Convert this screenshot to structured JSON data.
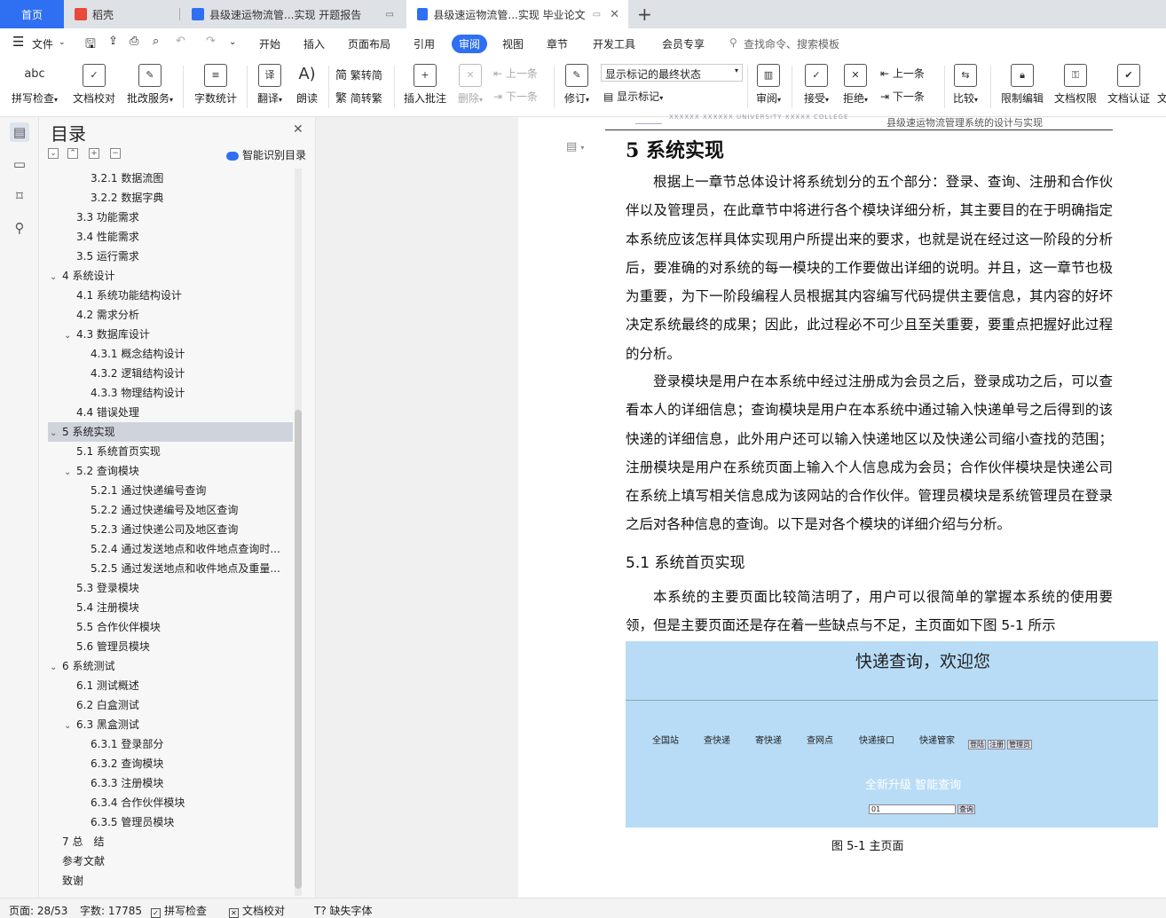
{
  "tabs": {
    "home": "首页",
    "daoke": "稻壳",
    "doc1": "县级速运物流管...实现 开题报告",
    "doc2": "县级速运物流管...实现 毕业论文",
    "add": "+"
  },
  "menu": {
    "file": "文件",
    "items": [
      "开始",
      "插入",
      "页面布局",
      "引用",
      "审阅",
      "视图",
      "章节",
      "开发工具",
      "会员专享"
    ],
    "search": "查找命令、搜索模板"
  },
  "ribbon": {
    "spellcheck": "拼写检查",
    "spellcheck_icon": "abc",
    "doc_proof": "文档校对",
    "correction_service": "批改服务",
    "word_count": "字数统计",
    "translate": "翻译",
    "read_aloud": "朗读",
    "trad_to_simp": "繁转简",
    "simp_to_trad": "简转繁",
    "insert_comment": "插入批注",
    "delete": "删除",
    "prev_comment": "上一条",
    "next_comment": "下一条",
    "track_changes": "修订",
    "markup_state": "显示标记的最终状态",
    "show_markup": "显示标记",
    "review_pane": "审阅",
    "accept": "接受",
    "reject": "拒绝",
    "prev_change": "上一条",
    "next_change": "下一条",
    "compare": "比较",
    "restrict_edit": "限制编辑",
    "doc_permission": "文档权限",
    "doc_certify": "文档认证",
    "more": "文"
  },
  "toc": {
    "title": "目录",
    "smart_label": "智能识别目录",
    "items": [
      {
        "text": "3.2.1 数据流图",
        "level": 3
      },
      {
        "text": "3.2.2 数据字典",
        "level": 3
      },
      {
        "text": "3.3 功能需求",
        "level": 2
      },
      {
        "text": "3.4 性能需求",
        "level": 2
      },
      {
        "text": "3.5 运行需求",
        "level": 2
      },
      {
        "text": "4 系统设计",
        "level": 1,
        "caret": true
      },
      {
        "text": "4.1 系统功能结构设计",
        "level": 2
      },
      {
        "text": "4.2 需求分析",
        "level": 2
      },
      {
        "text": "4.3 数据库设计",
        "level": 2,
        "caret": true
      },
      {
        "text": "4.3.1 概念结构设计",
        "level": 3
      },
      {
        "text": "4.3.2 逻辑结构设计",
        "level": 3
      },
      {
        "text": "4.3.3 物理结构设计",
        "level": 3
      },
      {
        "text": "4.4 错误处理",
        "level": 2
      },
      {
        "text": "5 系统实现",
        "level": 1,
        "caret": true,
        "selected": true
      },
      {
        "text": "5.1 系统首页实现",
        "level": 2
      },
      {
        "text": "5.2 查询模块",
        "level": 2,
        "caret": true
      },
      {
        "text": "5.2.1 通过快递编号查询",
        "level": 3
      },
      {
        "text": "5.2.2 通过快递编号及地区查询",
        "level": 3
      },
      {
        "text": "5.2.3 通过快递公司及地区查询",
        "level": 3
      },
      {
        "text": "5.2.4 通过发送地点和收件地点查询时...",
        "level": 3
      },
      {
        "text": "5.2.5 通过发送地点和收件地点及重量...",
        "level": 3
      },
      {
        "text": "5.3 登录模块",
        "level": 2
      },
      {
        "text": "5.4 注册模块",
        "level": 2
      },
      {
        "text": "5.5 合作伙伴模块",
        "level": 2
      },
      {
        "text": "5.6 管理员模块",
        "level": 2
      },
      {
        "text": "6 系统测试",
        "level": 1,
        "caret": true
      },
      {
        "text": "6.1 测试概述",
        "level": 2
      },
      {
        "text": "6.2 白盒测试",
        "level": 2
      },
      {
        "text": "6.3 黑盒测试",
        "level": 2,
        "caret": true
      },
      {
        "text": "6.3.1 登录部分",
        "level": 3
      },
      {
        "text": "6.3.2 查询模块",
        "level": 3
      },
      {
        "text": "6.3.3 注册模块",
        "level": 3
      },
      {
        "text": "6.3.4 合作伙伴模块",
        "level": 3
      },
      {
        "text": "6.3.5 管理员模块",
        "level": 3
      },
      {
        "text": "7 总　结",
        "level": 1
      },
      {
        "text": "参考文献",
        "level": 1
      },
      {
        "text": "致谢",
        "level": 1
      }
    ]
  },
  "document": {
    "header_logo_text": "XXXXXX XXXXXX UNIVERSITY XXXXX COLLEGE",
    "header_text": "县级速运物流管理系统的设计与实现",
    "heading": "5 系统实现",
    "para1": "根据上一章节总体设计将系统划分的五个部分：登录、查询、注册和合作伙伴以及管理员，在此章节中将进行各个模块详细分析，其主要目的在于明确指定本系统应该怎样具体实现用户所提出来的要求，也就是说在经过这一阶段的分析后，要准确的对系统的每一模块的工作要做出详细的说明。并且，这一章节也极为重要，为下一阶段编程人员根据其内容编写代码提供主要信息，其内容的好坏决定系统最终的成果；因此，此过程必不可少且至关重要，要重点把握好此过程的分析。",
    "para2": "登录模块是用户在本系统中经过注册成为会员之后，登录成功之后，可以查看本人的详细信息；查询模块是用户在本系统中通过输入快递单号之后得到的该快递的详细信息，此外用户还可以输入快递地区以及快递公司缩小查找的范围；注册模块是用户在系统页面上输入个人信息成为会员；合作伙伴模块是快递公司在系统上填写相关信息成为该网站的合作伙伴。管理员模块是系统管理员在登录之后对各种信息的查询。以下是对各个模块的详细介绍与分析。",
    "subheading": "5.1 系统首页实现",
    "para3": "本系统的主要页面比较简洁明了，用户可以很简单的掌握本系统的使用要领，但是主要页面还是存在着一些缺点与不足，主页面如下图 5-1 所示",
    "screenshot": {
      "title": "快递查询，欢迎您",
      "nav": [
        "全国站",
        "查快递",
        "寄快递",
        "查网点",
        "快递接口",
        "快递管家"
      ],
      "small_buttons": [
        "登陆",
        "注册",
        "管理员"
      ],
      "slogan": "全新升级 智能查询",
      "input_value": "01",
      "query_button": "查询"
    },
    "caption": "图 5-1  主页面"
  },
  "status": {
    "page": "页面: 28/53",
    "words": "字数: 17785",
    "spellcheck": "拼写检查",
    "proof": "文档校对",
    "missing_font": "缺失字体"
  },
  "colors": {
    "accent": "#2f6ff2",
    "screenshot_bg": "#b8dcf6"
  }
}
